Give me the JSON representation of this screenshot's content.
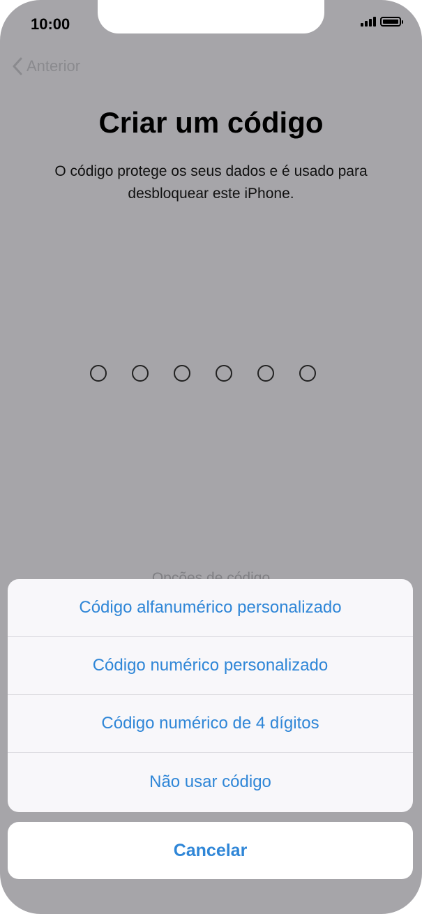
{
  "status_bar": {
    "time": "10:00"
  },
  "nav": {
    "back_label": "Anterior"
  },
  "page": {
    "title": "Criar um código",
    "subtitle": "O código protege os seus dados e é usado para desbloquear este iPhone.",
    "passcode_dots": 6,
    "options_link": "Opções de código"
  },
  "action_sheet": {
    "items": [
      {
        "label": "Código alfanumérico personalizado"
      },
      {
        "label": "Código numérico personalizado"
      },
      {
        "label": "Código numérico de 4 dígitos"
      },
      {
        "label": "Não usar código"
      }
    ],
    "cancel_label": "Cancelar"
  },
  "colors": {
    "accent": "#2f86d7",
    "dim_background": "#a6a5a9",
    "sheet_background": "#f8f7fa"
  }
}
